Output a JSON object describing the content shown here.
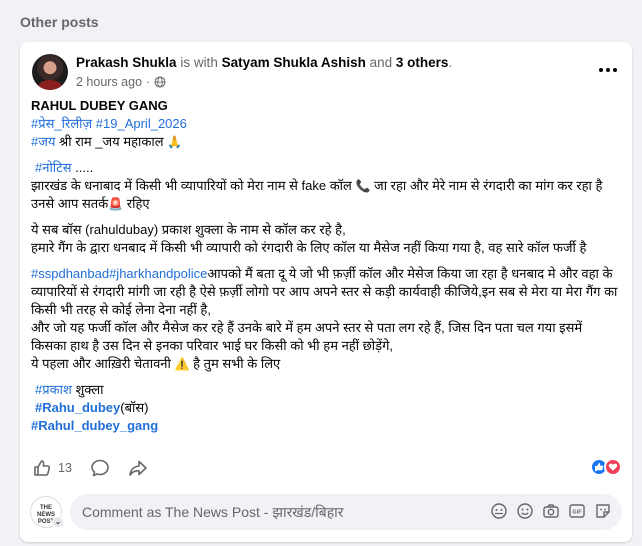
{
  "section_title": "Other posts",
  "post": {
    "author": "Prakash Shukla",
    "with_text": " is with ",
    "tagged": "Satyam Shukla Ashish",
    "and_text": " and ",
    "others": "3 others",
    "period": ".",
    "time": "2 hours ago",
    "dot": "·",
    "icons": {
      "more": "more-icon",
      "audience": "globe-icon"
    },
    "body": {
      "title": "RAHUL DUBEY GANG",
      "tag_press": "#प्रेस_रिलीज़",
      "tag_date": "#19_April_2026",
      "tag_jai": "#जय",
      "jai_text": " श्री राम _जय महाकाल ",
      "emoji_pray": "🙏",
      "tag_notice": "#नोटिस",
      "notice_dots": " .....",
      "line1a": "झारखंड के धनाबाद में किसी भी व्यापारियों को  मेरा नाम से fake कॉल ",
      "emoji_phone": "📞",
      "line1b": " जा रहा और मेरे नाम से रंगदारी का मांग कर रहा है उनसे आप सतर्क",
      "emoji_siren": "🚨",
      "line1c": " रहिए",
      "line2": "ये सब बॉस (rahuldubay) प्रकाश शुक्ला के नाम से कॉल कर रहे है,",
      "line3": " हमारे गैंग के द्वारा धनबाद में किसी भी व्यापारी को रंगदारी के लिए कॉल या मैसेज नहीं किया गया है, वह सारे कॉल फर्जी है",
      "tag_sspdhanbad": "#sspdhanbad",
      "tag_jhpolice": "#jharkhandpolice",
      "line4": "आपको मैं बता दू ये जो भी फ़र्ज़ी कॉल और मेसेज किया जा रहा है धनबाद मे और वहा के व्यापारियों से रंगदारी मांगी जा रही है ऐसे फ़र्ज़ी लोगो पर आप अपने स्तर से कड़ी कार्यवाही कीजिये,इन सब से मेरा या मेरा गैंग का किसी भी तरह से कोई लेना देना नहीं है,",
      "line5": "और जो यह फर्जी कॉल और मैसेज कर रहे हैं उनके बारे में हम अपने स्तर से पता लग रहे हैं, जिस दिन पता चल गया इसमें किसका हाथ है उस दिन से इनका परिवार भाई घर किसी को भी हम नहीं छोड़ेंगे,",
      "line6a": "ये पहला और आख़िरी चेतावनी ",
      "emoji_warning": "⚠️",
      "line6b": " है तुम सभी के लिए",
      "tag_prakash": "#प्रकाश",
      "prakash_rest": " शुक्ला",
      "tag_rahu": "#Rahu_dubey",
      "rahu_rest": "(बॉस)",
      "tag_gang": "#Rahul_dubey_gang"
    },
    "reactions": {
      "like_count": "13",
      "icons": {
        "like": "like-icon",
        "comment": "comment-icon",
        "share": "share-icon"
      }
    },
    "comment": {
      "placeholder": "Comment as The News Post - झारखंड/बिहार",
      "avatar_text": "THE NEWS POST"
    }
  },
  "colors": {
    "link": "#216fdb",
    "muted": "#65676b",
    "like": "#1877f2",
    "love": "#f33e58"
  }
}
